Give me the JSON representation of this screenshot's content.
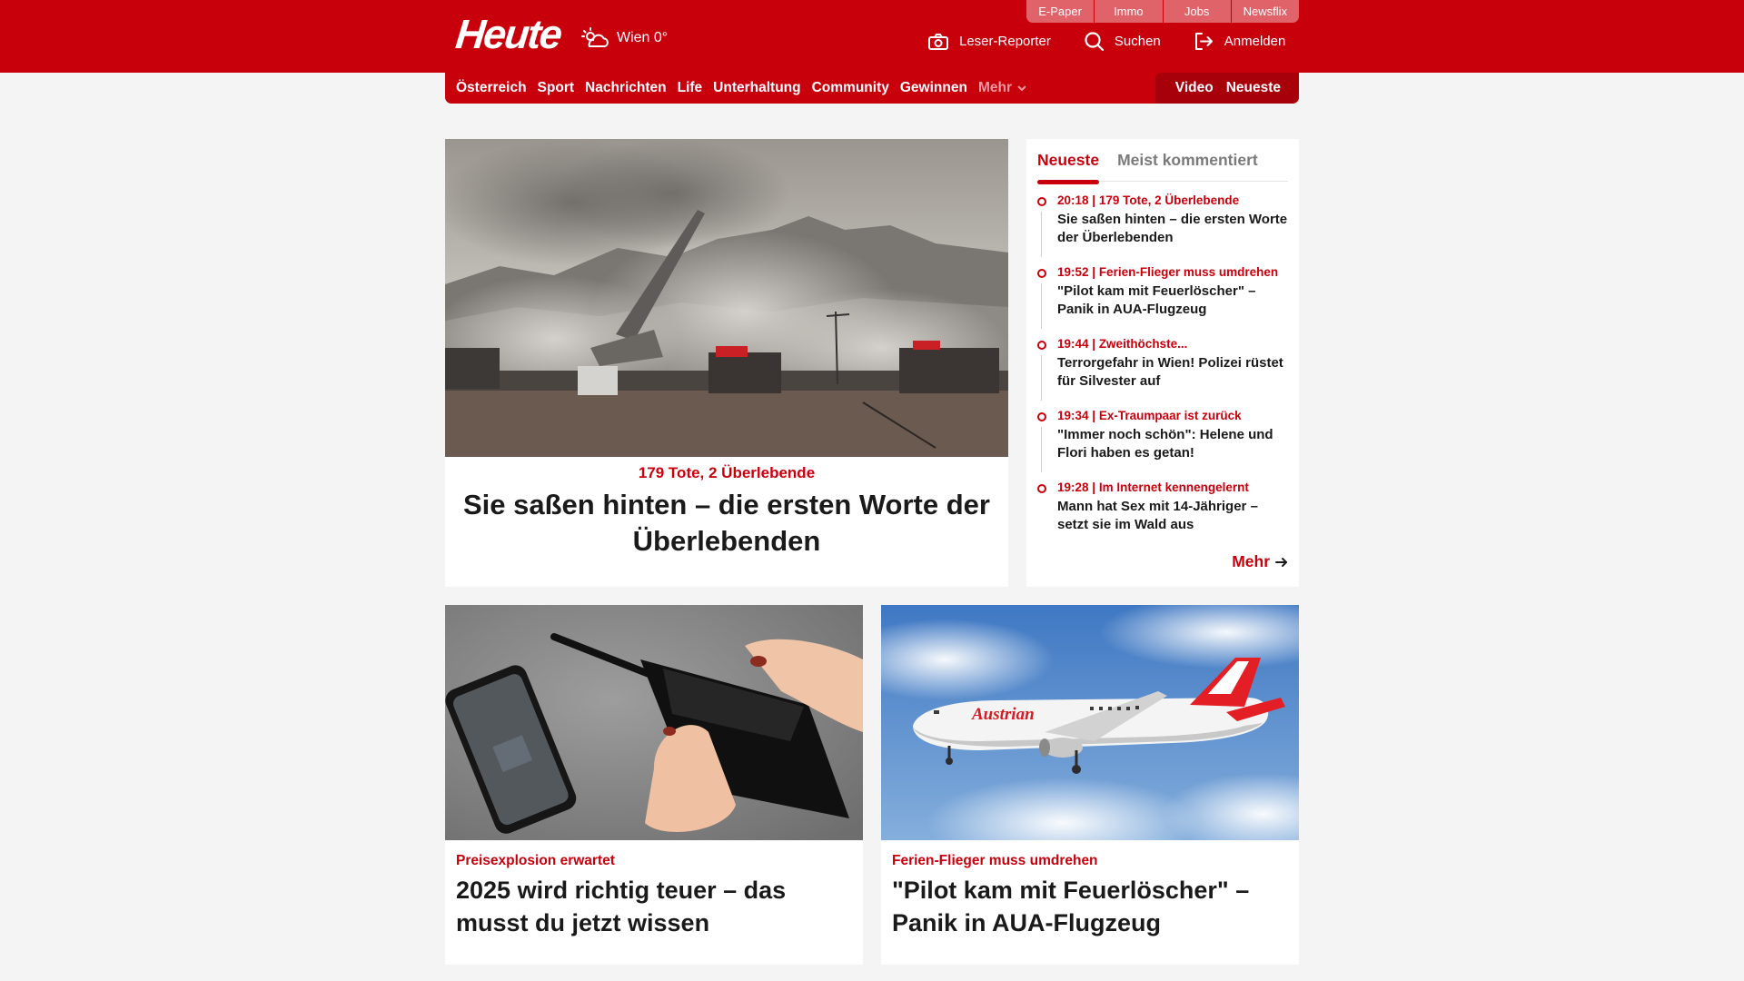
{
  "header": {
    "logo": "Heute",
    "weather": {
      "location_temp": "Wien 0°",
      "icon": "partly-cloudy-icon"
    },
    "services": [
      "E-Paper",
      "Immo",
      "Jobs",
      "Newsflix"
    ],
    "actions": [
      {
        "label": "Leser-Reporter",
        "icon": "camera-icon"
      },
      {
        "label": "Suchen",
        "icon": "search-icon"
      },
      {
        "label": "Anmelden",
        "icon": "login-icon"
      }
    ]
  },
  "nav": {
    "items": [
      "Österreich",
      "Sport",
      "Nachrichten",
      "Life",
      "Unterhaltung",
      "Community",
      "Gewinnen"
    ],
    "more": "Mehr",
    "right": [
      "Video",
      "Neueste"
    ]
  },
  "hero": {
    "kicker": "179 Tote, 2 Überlebende",
    "title": "Sie saßen hinten – die ersten Worte der Überlebenden",
    "image": "plane-crash-smoke-image"
  },
  "sidebar": {
    "tabs": [
      "Neueste",
      "Meist kommentiert"
    ],
    "active_tab": "Neueste",
    "items": [
      {
        "time": "20:18",
        "kicker": "179 Tote, 2 Überlebende",
        "title": "Sie saßen hinten – die ersten Worte der Überlebenden"
      },
      {
        "time": "19:52",
        "kicker": "Ferien-Flieger muss umdrehen",
        "title": "\"Pilot kam mit Feuerlöscher\" – Panik in AUA-Flugzeug"
      },
      {
        "time": "19:44",
        "kicker": "Zweithöchste...",
        "title": "Terrorgefahr in Wien! Polizei rüstet für Silvester auf"
      },
      {
        "time": "19:34",
        "kicker": "Ex-Traumpaar ist zurück",
        "title": "\"Immer noch schön\": Helene und Flori haben es getan!"
      },
      {
        "time": "19:28",
        "kicker": "Im Internet kennengelernt",
        "title": "Mann hat Sex mit 14-Jähriger – setzt sie im Wald aus"
      }
    ],
    "more": "Mehr"
  },
  "cards": [
    {
      "kicker": "Preisexplosion erwartet",
      "title": "2025 wird richtig teuer – das musst du jetzt wissen",
      "image": "empty-wallet-phone-image"
    },
    {
      "kicker": "Ferien-Flieger muss umdrehen",
      "title": "\"Pilot kam mit Feuerlöscher\" – Panik in AUA-Flugzeug",
      "image": "austrian-airplane-image",
      "image_text": "Austrian"
    }
  ],
  "colors": {
    "brand": "#c8000c",
    "brand_dark": "#a7000a",
    "background": "#f4f4f4"
  }
}
